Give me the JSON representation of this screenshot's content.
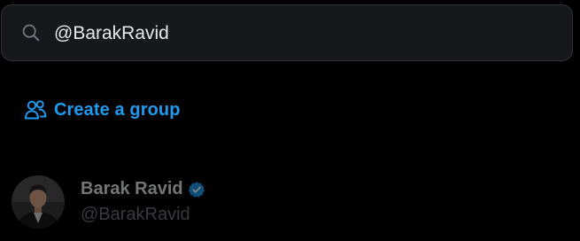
{
  "search": {
    "value": "@BarakRavid",
    "icon": "search-icon"
  },
  "actions": {
    "create_group_label": "Create a group",
    "create_group_icon": "people-icon"
  },
  "results": [
    {
      "display_name": "Barak Ravid",
      "handle": "@BarakRavid",
      "verified": true,
      "avatar_icon": "avatar-photo"
    }
  ],
  "colors": {
    "accent": "#1d9bf0",
    "background": "#000000",
    "search_background": "#16181c",
    "secondary_text": "#71767b"
  }
}
